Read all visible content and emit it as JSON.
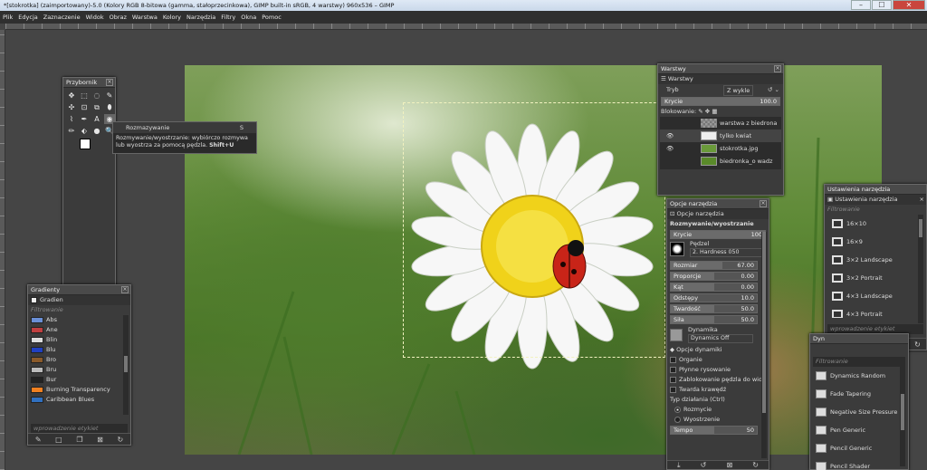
{
  "window": {
    "title": "*[stokrotka] (zaimportowany)-5.0 (Kolory RGB 8-bitowa (gamma, stałoprzecinkowa), GIMP built-in sRGB, 4 warstwy) 960x536 – GIMP",
    "minimize": "–",
    "maximize": "☐",
    "close": "✕"
  },
  "menu": [
    "Plik",
    "Edycja",
    "Zaznaczenie",
    "Widok",
    "Obraz",
    "Warstwa",
    "Kolory",
    "Narzędzia",
    "Filtry",
    "Okna",
    "Pomoc"
  ],
  "toolbox": {
    "title": "Przybornik",
    "tools": [
      "✥",
      "⬚",
      "◌",
      "✎",
      "✣",
      "⊡",
      "⧉",
      "⬮",
      "⌇",
      "✒",
      "A",
      "◉",
      "✏",
      "⬖",
      "●",
      "🔍"
    ],
    "tooltip_header": "Rozmazywanie",
    "tooltip_shortcut": "S",
    "tooltip_line1": "Rozmywanie/wyostrzanie: wybiórczo rozmywa",
    "tooltip_line2": "lub wyostrza za pomocą pędzla.",
    "tooltip_key": "Shift+U"
  },
  "gradients": {
    "title": "Gradienty",
    "tab": "Gradien",
    "filter": "Filtrowanie",
    "items": [
      "Abs",
      "Ane",
      "Blin",
      "Blu",
      "Bro",
      "Bru",
      "Bur",
      "Burning Transparency",
      "Caribbean Blues"
    ],
    "colors": [
      "#6a8fd6",
      "#c04040",
      "#ddd",
      "#2040c0",
      "#8a5a2a",
      "#bbb",
      "#222",
      "#f08020",
      "#3070c0"
    ],
    "tag_placeholder": "wprowadzenie etykiet"
  },
  "layers": {
    "title": "Warstwy",
    "tab": "Warstwy",
    "mode_label": "Tryb",
    "mode_value": "Z wykle",
    "opacity_label": "Krycie",
    "opacity_value": "100.0",
    "lock_label": "Blokowanie:",
    "items": [
      "warstwa z biedrona",
      "tylko kwiat",
      "stokrotka.jpg",
      "biedronka_o wadz"
    ],
    "visible": [
      false,
      true,
      true,
      false
    ]
  },
  "tool_options": {
    "title": "Opcje narzędzia",
    "tab": "Opcje narzędzia",
    "tool_name": "Rozmywanie/wyostrzanie",
    "opacity_label": "Krycie",
    "opacity_value": "100",
    "brush_label": "Pędzel",
    "brush_value": "2. Hardness 050",
    "size_label": "Rozmiar",
    "size_value": "67.00",
    "aspect_label": "Proporcje",
    "aspect_value": "0.00",
    "angle_label": "Kąt",
    "angle_value": "0.00",
    "spacing_label": "Odstępy",
    "spacing_value": "10.0",
    "hardness_label": "Twardość",
    "hardness_value": "50.0",
    "force_label": "Siła",
    "force_value": "50.0",
    "dynamics_label": "Dynamika",
    "dynamics_value": "Dynamics Off",
    "dyn_options": "Opcje dynamiki",
    "clip": "Organie",
    "smooth": "Płynne rysowanie",
    "lock_brush": "Zablokowanie pędzla do wid",
    "hard_edge": "Twarda krawędź",
    "conv_label": "Typ działania (Ctrl)",
    "blur": "Rozmycie",
    "sharpen": "Wyostrzenie",
    "rate_label": "Tempo",
    "rate_value": "50"
  },
  "tool_presets": {
    "title": "Ustawienia narzędzia",
    "tab": "Ustawienia narzędzia",
    "filter": "Filtrowanie",
    "items": [
      "16×10",
      "16×9",
      "3×2 Landscape",
      "3×2 Portrait",
      "4×3 Landscape",
      "4×3 Portrait"
    ],
    "tag_placeholder": "wprowadzenie etykiet"
  },
  "dynamics": {
    "title": "Dyn",
    "filter": "Filtrowanie",
    "items": [
      "Dynamics Random",
      "Fade Tapering",
      "Negative Size Pressure",
      "Pen Generic",
      "Pencil Generic",
      "Pencil Shader"
    ]
  }
}
